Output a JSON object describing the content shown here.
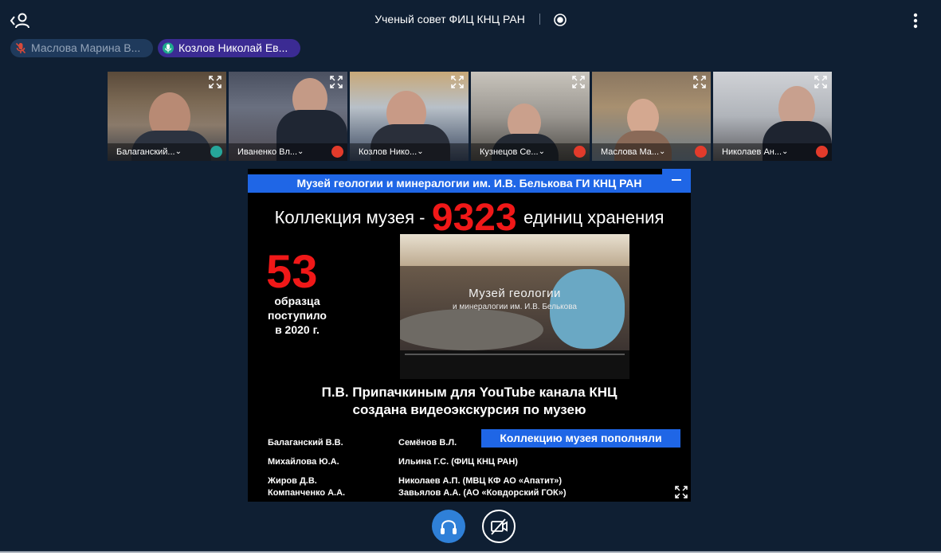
{
  "header": {
    "title": "Ученый совет ФИЦ КНЦ РАН",
    "back_users_icon": "back-users-icon",
    "record_icon": "record-icon",
    "menu_icon": "more-vertical-icon"
  },
  "chips": [
    {
      "label": "Маслова Марина В...",
      "icon": "mic-muted-icon"
    },
    {
      "label": "Козлов Николай Ев...",
      "icon": "mic-icon"
    }
  ],
  "participants": [
    {
      "name": "Балаганский...",
      "status": "headphones"
    },
    {
      "name": "Иваненко Вл...",
      "status": "muted"
    },
    {
      "name": "Козлов Нико...",
      "status": "speaking"
    },
    {
      "name": "Кузнецов Се...",
      "status": "muted"
    },
    {
      "name": "Маслова Ма...",
      "status": "muted"
    },
    {
      "name": "Николаев Ан...",
      "status": "muted"
    }
  ],
  "slide": {
    "header": "Музей геологии и минералогии им. И.В. Белькова ГИ КНЦ РАН",
    "collection_prefix": "Коллекция музея -",
    "collection_count": "9323",
    "collection_suffix": "единиц хранения",
    "received_count": "53",
    "received_line1": "образца",
    "received_line2": "поступило",
    "received_line3": "в 2020 г.",
    "video_title_line1": "Музей геологии",
    "video_title_line2": "и минералогии им. И.В. Белькова",
    "youtube_line1": "П.В. Припачкиным для YouTube канала КНЦ",
    "youtube_line2": "создана видеоэкскурсия по музею",
    "contributors_title": "Коллекцию музея пополняли",
    "contributors_left": [
      "Балаганский В.В.",
      "Михайлова Ю.А.",
      "Жиров Д.В.",
      "Компанченко А.А."
    ],
    "contributors_right": [
      "Семёнов В.Л.",
      "Ильина Г.С. (ФИЦ КНЦ РАН)",
      "Николаев А.П. (МВЦ КФ АО «Апатит»)",
      "Завьялов А.А. (АО «Ковдорский ГОК»)"
    ]
  },
  "controls": {
    "audio_icon": "headphones-icon",
    "video_icon": "camera-off-icon"
  },
  "colors": {
    "background": "#0f1f33",
    "accent": "#1f66e6",
    "highlight": "#f01818",
    "speaking_chip": "#3b2b93",
    "muted": "#e23b2b"
  }
}
